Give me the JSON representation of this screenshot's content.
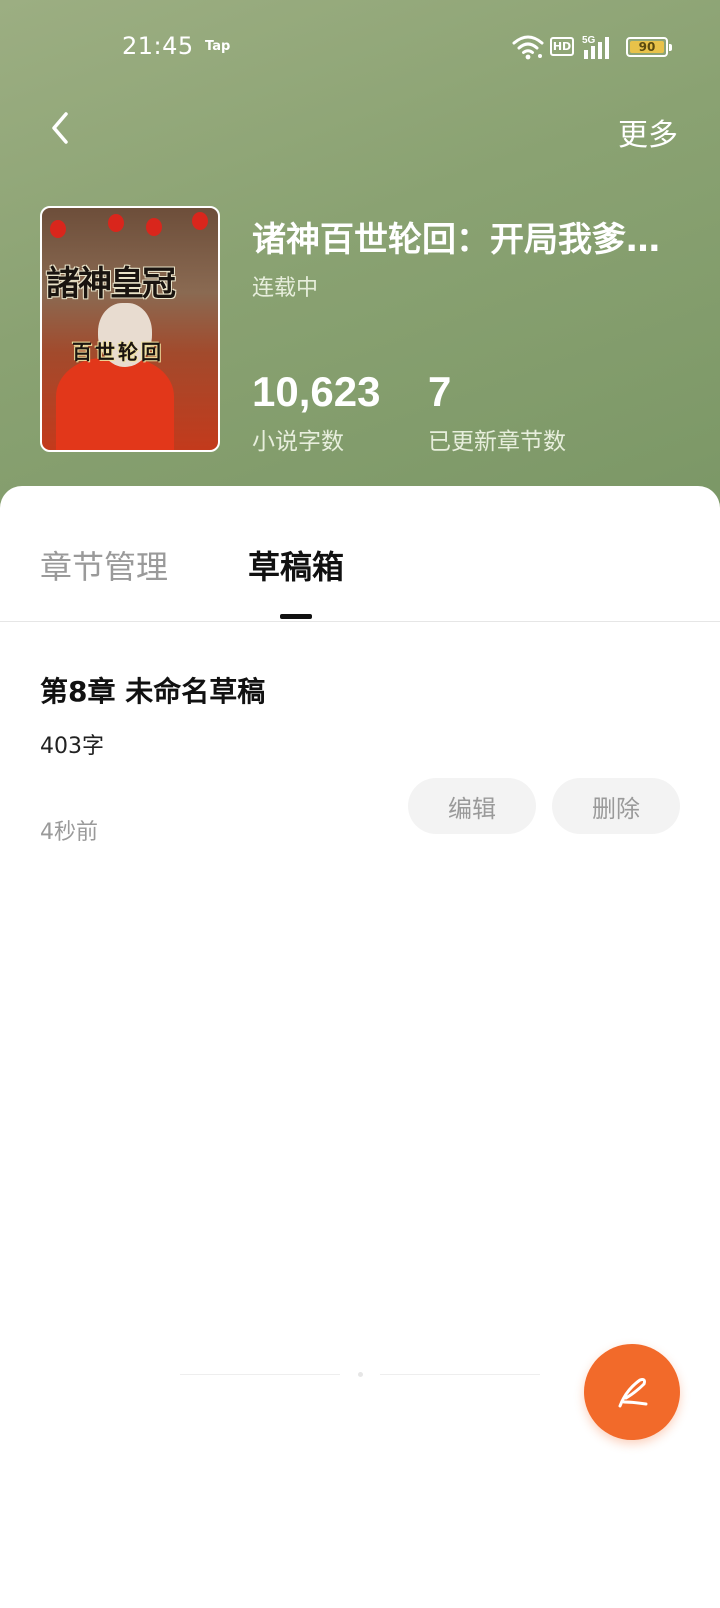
{
  "status_bar": {
    "time": "21:45",
    "carrier_badge": "Tap",
    "hd_badge": "HD",
    "network_badge": "5G",
    "battery_level": "90",
    "battery_color": "#e8c24a"
  },
  "nav": {
    "back_icon": "chevron-left-icon",
    "more_label": "更多"
  },
  "book": {
    "title": "诸神百世轮回：开局我爹…",
    "status": "连载中",
    "cover_title": "諸神皇冠",
    "cover_subtitle": "百世轮回",
    "stats": [
      {
        "value": "10,623",
        "label": "小说字数"
      },
      {
        "value": "7",
        "label": "已更新章节数"
      }
    ]
  },
  "tabs": [
    {
      "label": "章节管理",
      "active": false
    },
    {
      "label": "草稿箱",
      "active": true
    }
  ],
  "drafts": [
    {
      "title": "第8章 未命名草稿",
      "word_count": "403字",
      "updated": "4秒前",
      "edit_label": "编辑",
      "delete_label": "删除"
    }
  ],
  "fab": {
    "icon": "quill-pen-icon",
    "color": "#f26a2a"
  },
  "colors": {
    "hero_bg": "#8aa272",
    "accent": "#f26a2a"
  }
}
